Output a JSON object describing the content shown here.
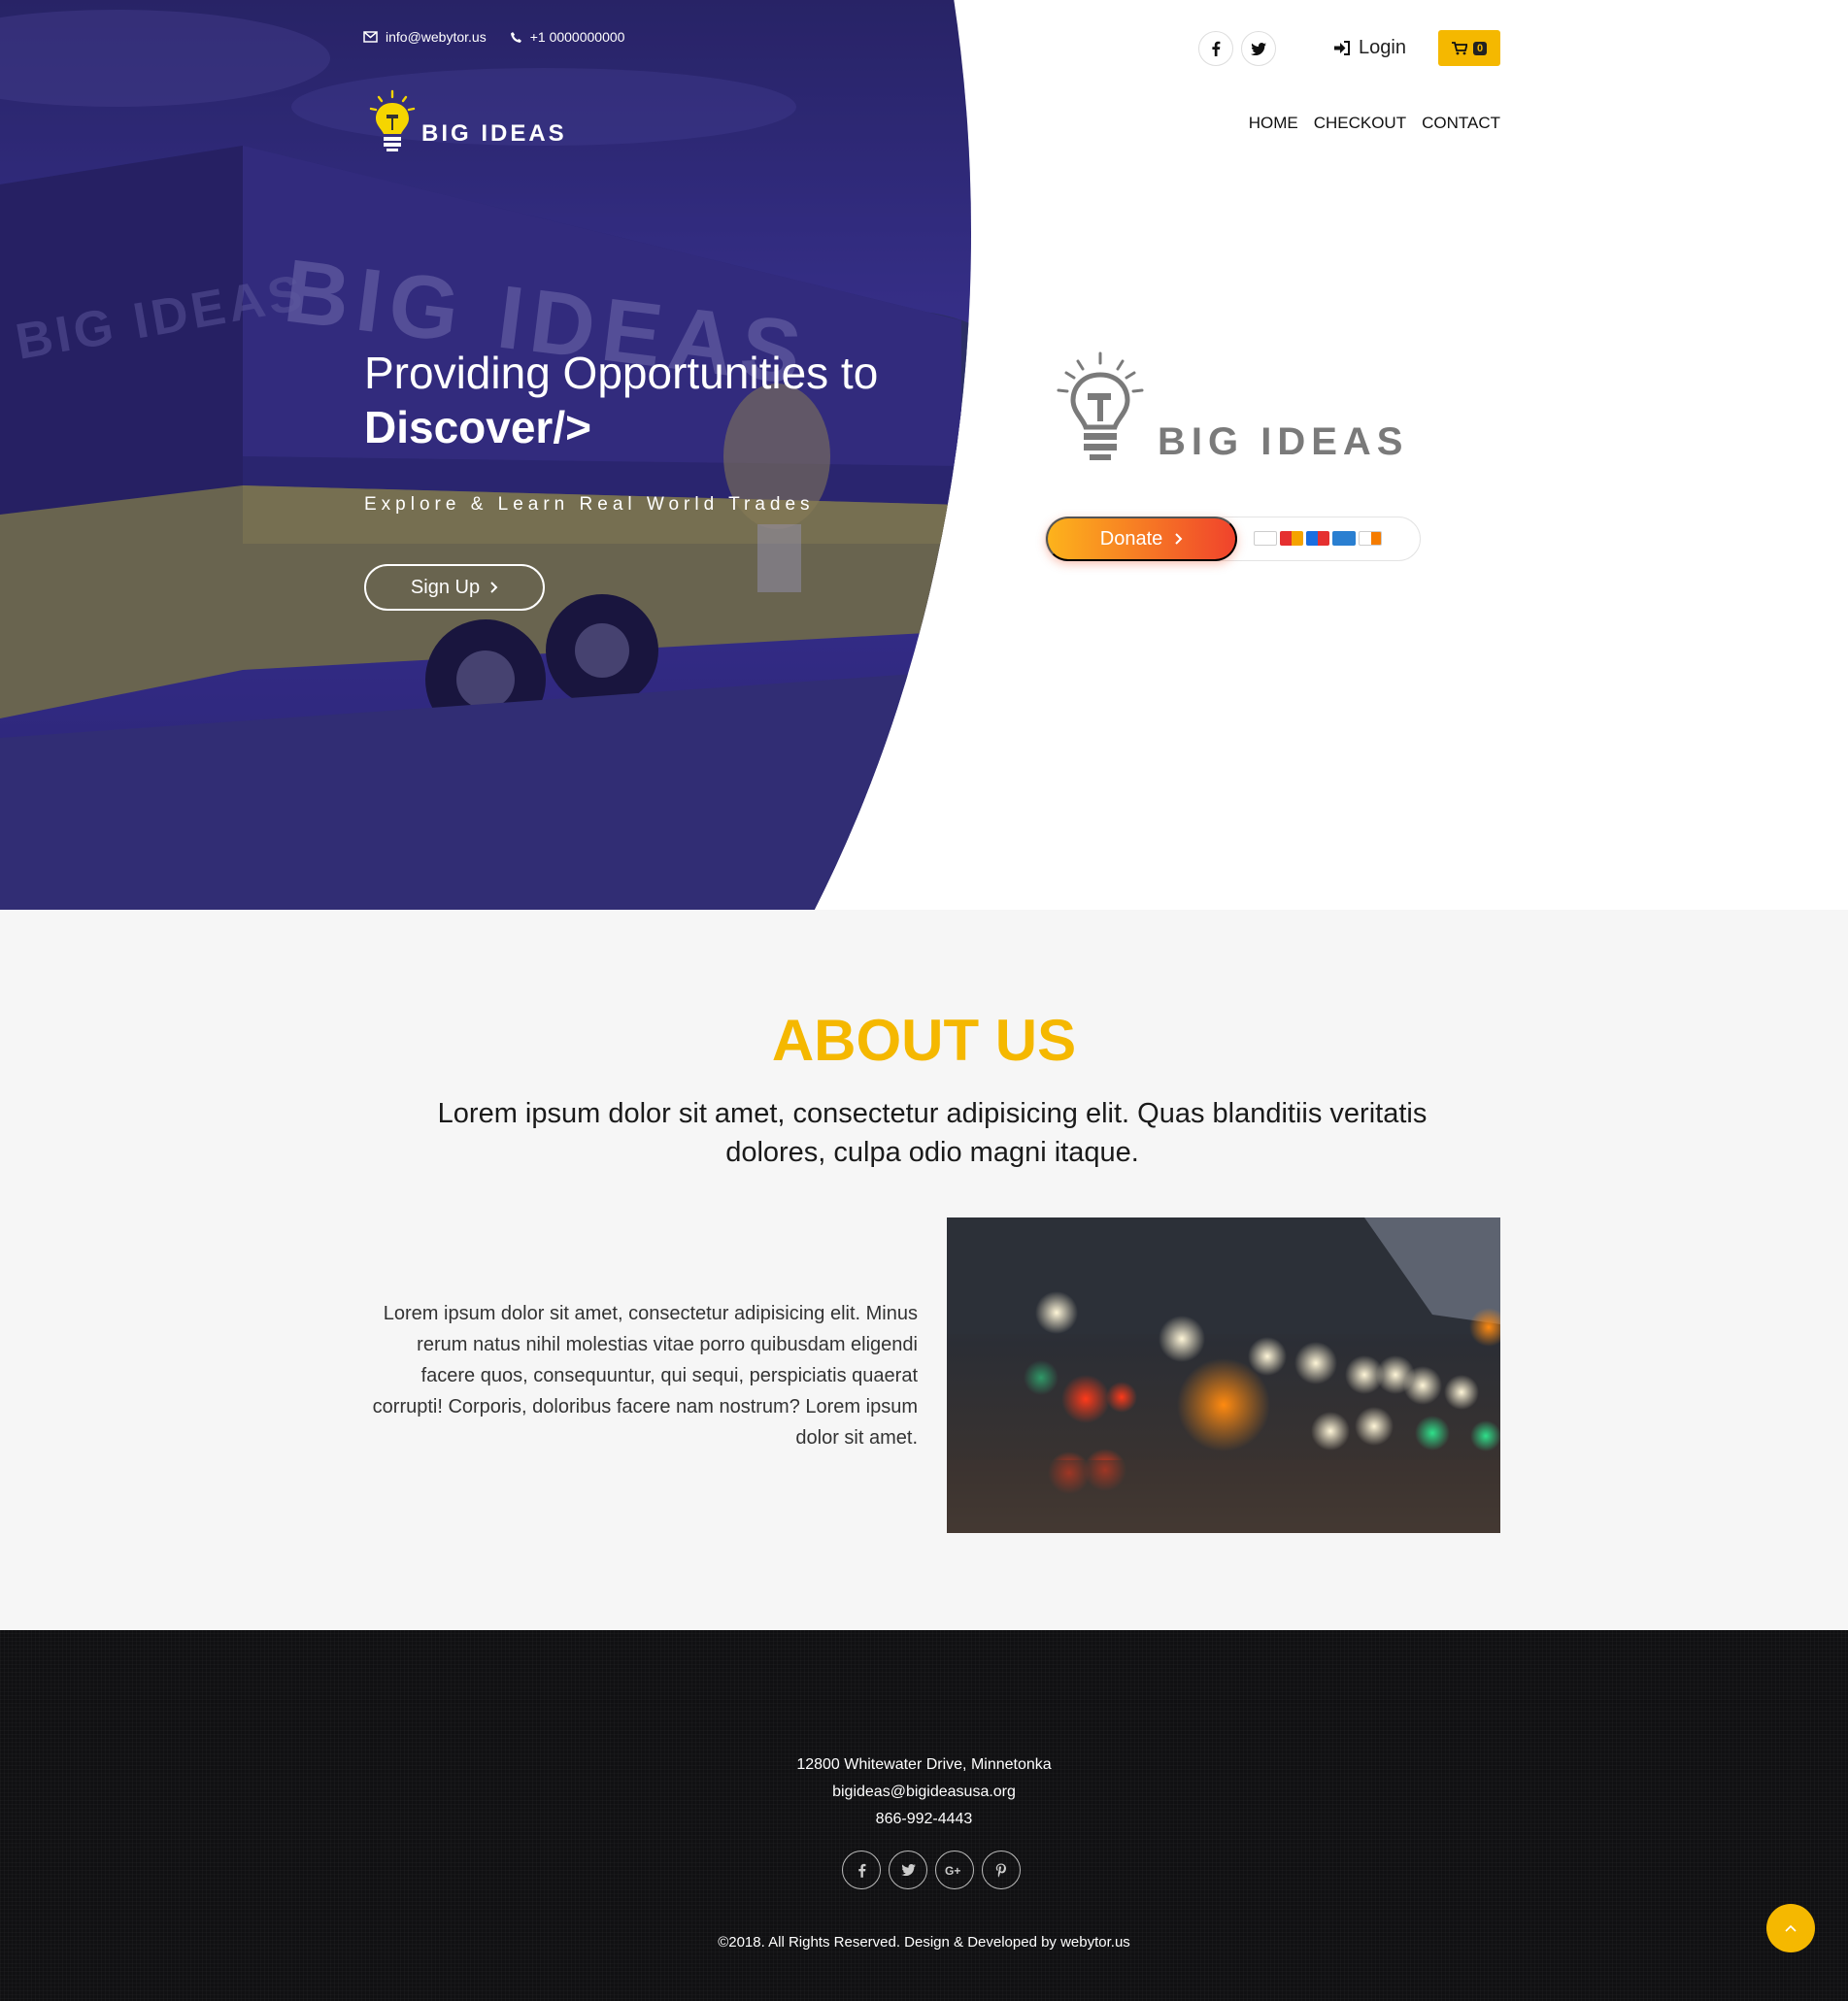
{
  "topbar": {
    "email": "info@webytor.us",
    "phone": "+1 0000000000"
  },
  "brand": {
    "name": "BIG IDEAS"
  },
  "hero": {
    "title_line1": "Providing Opportunities to",
    "title_line2": "Discover/>",
    "tagline": "Explore & Learn Real World Trades",
    "signup_label": "Sign Up"
  },
  "header": {
    "login_label": "Login",
    "cart_count": "0",
    "nav": [
      "HOME",
      "CHECKOUT",
      "CONTACT"
    ]
  },
  "donate": {
    "label": "Donate",
    "cards": [
      "visa",
      "mastercard",
      "maestro",
      "amex",
      "discover"
    ]
  },
  "about": {
    "title": "ABOUT US",
    "lead": "Lorem ipsum dolor sit amet, consectetur adipisicing elit. Quas blanditiis veritatis dolores, culpa odio magni itaque.",
    "body": "Lorem ipsum dolor sit amet, consectetur adipisicing elit. Minus rerum natus nihil molestias vitae porro quibusdam eligendi facere quos, consequuntur, qui sequi, perspiciatis quaerat corrupti! Corporis, doloribus facere nam nostrum? Lorem ipsum dolor sit amet."
  },
  "footer": {
    "address": "12800 Whitewater Drive, Minnetonka",
    "email": "bigideas@bigideasusa.org",
    "phone": "866-992-4443",
    "social": [
      "facebook",
      "twitter",
      "google-plus",
      "pinterest"
    ],
    "copyright": "©2018. All Rights Reserved. Design & Developed by  webytor.us"
  },
  "colors": {
    "accent": "#f5b800",
    "hero_overlay": "#3a3488",
    "donate_start": "#fdb31c",
    "donate_end": "#f0432c",
    "footer_bg": "#101012"
  }
}
